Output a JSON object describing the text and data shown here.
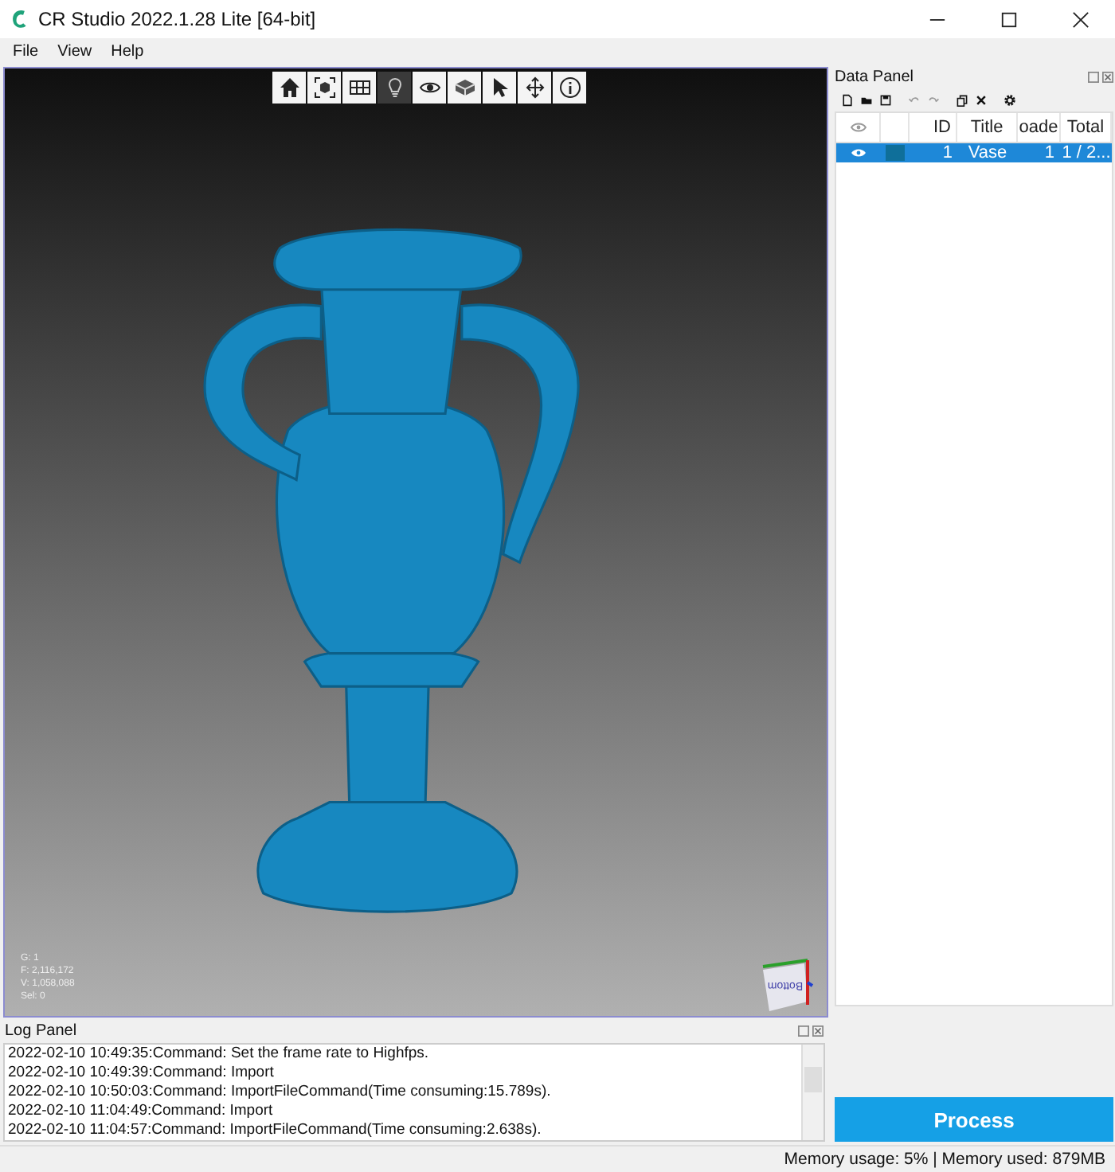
{
  "window": {
    "title": "CR Studio 2022.1.28 Lite [64-bit]"
  },
  "menu": [
    "File",
    "View",
    "Help"
  ],
  "toolbar": [
    {
      "kind": "home",
      "selected": false
    },
    {
      "kind": "frame",
      "selected": false
    },
    {
      "kind": "texture",
      "selected": false
    },
    {
      "kind": "light",
      "selected": true
    },
    {
      "kind": "eye",
      "selected": false
    },
    {
      "kind": "layers",
      "selected": false
    },
    {
      "kind": "pointer",
      "selected": false
    },
    {
      "kind": "move",
      "selected": false
    },
    {
      "kind": "info",
      "selected": false
    }
  ],
  "viewport": {
    "stats": [
      "G: 1",
      "F: 2,116,172",
      "V: 1,058,088",
      "Sel: 0"
    ],
    "gizmo_face": "Bottom"
  },
  "data_panel": {
    "title": "Data Panel",
    "columns": [
      "ID",
      "Title",
      "oade",
      "Total"
    ],
    "rows": [
      {
        "visible": true,
        "color": "#0f6f9a",
        "id": "1",
        "title": "Vase",
        "loaded": "1",
        "total": "1 / 2...",
        "selected": true
      }
    ]
  },
  "log_panel": {
    "title": "Log Panel",
    "lines": [
      "2022-02-10 10:49:35:Command: Set the frame rate to Highfps.",
      "2022-02-10 10:49:39:Command: Import",
      "2022-02-10 10:50:03:Command: ImportFileCommand(Time consuming:15.789s).",
      "2022-02-10 11:04:49:Command: Import",
      "2022-02-10 11:04:57:Command: ImportFileCommand(Time consuming:2.638s)."
    ]
  },
  "process_button": "Process",
  "status_bar": "Memory usage: 5% | Memory used: 879MB"
}
